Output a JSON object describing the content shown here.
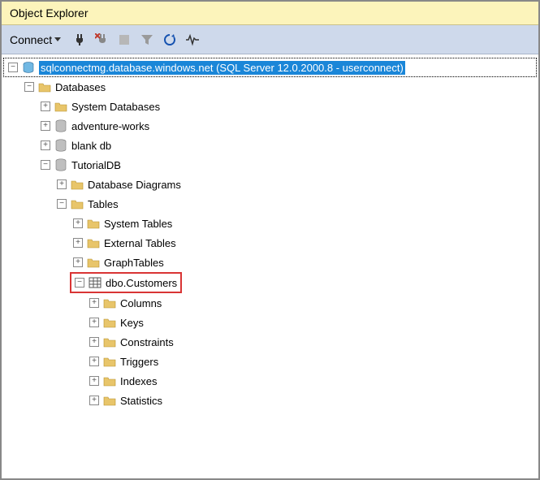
{
  "window": {
    "title": "Object Explorer"
  },
  "toolbar": {
    "connect_label": "Connect"
  },
  "tree": {
    "server": {
      "expander": "−",
      "label": "sqlconnectmg.database.windows.net (SQL Server 12.0.2000.8 - userconnect)"
    },
    "databases": {
      "expander": "−",
      "label": "Databases"
    },
    "system_databases": {
      "expander": "+",
      "label": "System Databases"
    },
    "adventure_works": {
      "expander": "+",
      "label": "adventure-works"
    },
    "blank_db": {
      "expander": "+",
      "label": "blank db"
    },
    "tutorial_db": {
      "expander": "−",
      "label": "TutorialDB"
    },
    "database_diagrams": {
      "expander": "+",
      "label": "Database Diagrams"
    },
    "tables": {
      "expander": "−",
      "label": "Tables"
    },
    "system_tables": {
      "expander": "+",
      "label": "System Tables"
    },
    "external_tables": {
      "expander": "+",
      "label": "External Tables"
    },
    "graph_tables": {
      "expander": "+",
      "label": "GraphTables"
    },
    "dbo_customers": {
      "expander": "−",
      "label": "dbo.Customers"
    },
    "columns": {
      "expander": "+",
      "label": "Columns"
    },
    "keys": {
      "expander": "+",
      "label": "Keys"
    },
    "constraints": {
      "expander": "+",
      "label": "Constraints"
    },
    "triggers": {
      "expander": "+",
      "label": "Triggers"
    },
    "indexes": {
      "expander": "+",
      "label": "Indexes"
    },
    "statistics": {
      "expander": "+",
      "label": "Statistics"
    }
  }
}
